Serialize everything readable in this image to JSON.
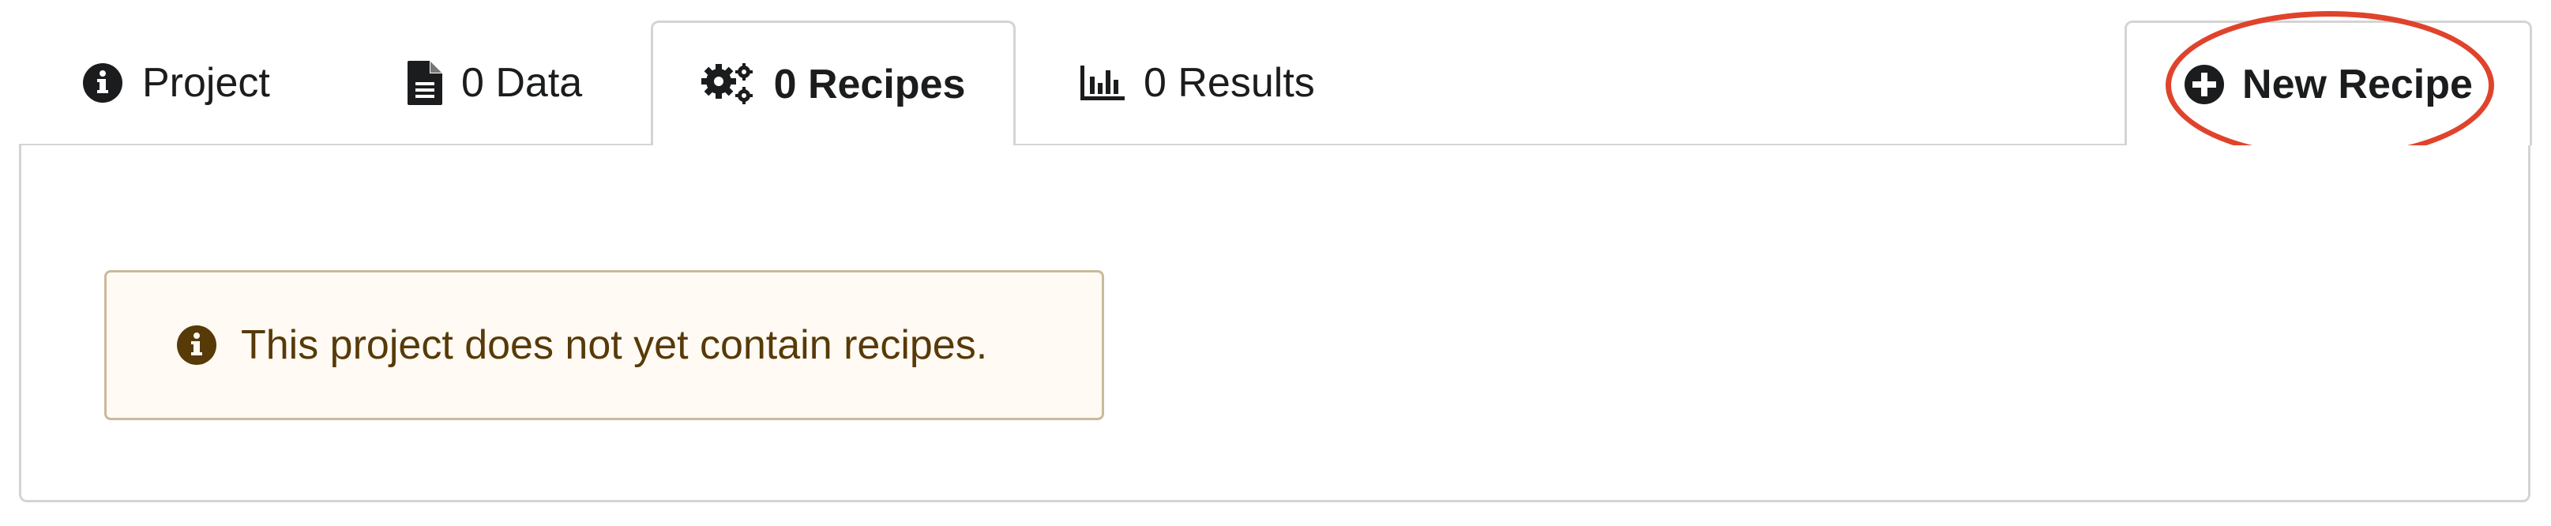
{
  "tabs": [
    {
      "label": "Project",
      "icon": "info-circle-icon"
    },
    {
      "label": "0 Data",
      "icon": "file-icon"
    },
    {
      "label": "0 Recipes",
      "icon": "gears-icon",
      "active": true
    },
    {
      "label": "0 Results",
      "icon": "bar-chart-icon"
    }
  ],
  "action": {
    "label": "New Recipe",
    "icon": "plus-circle-icon"
  },
  "message": {
    "text": "This project does not yet contain recipes.",
    "icon": "info-circle-icon"
  },
  "colors": {
    "highlight": "#e0432c",
    "message_bg": "#fffaf3",
    "message_text": "#573a08",
    "border": "#d4d4d5"
  }
}
